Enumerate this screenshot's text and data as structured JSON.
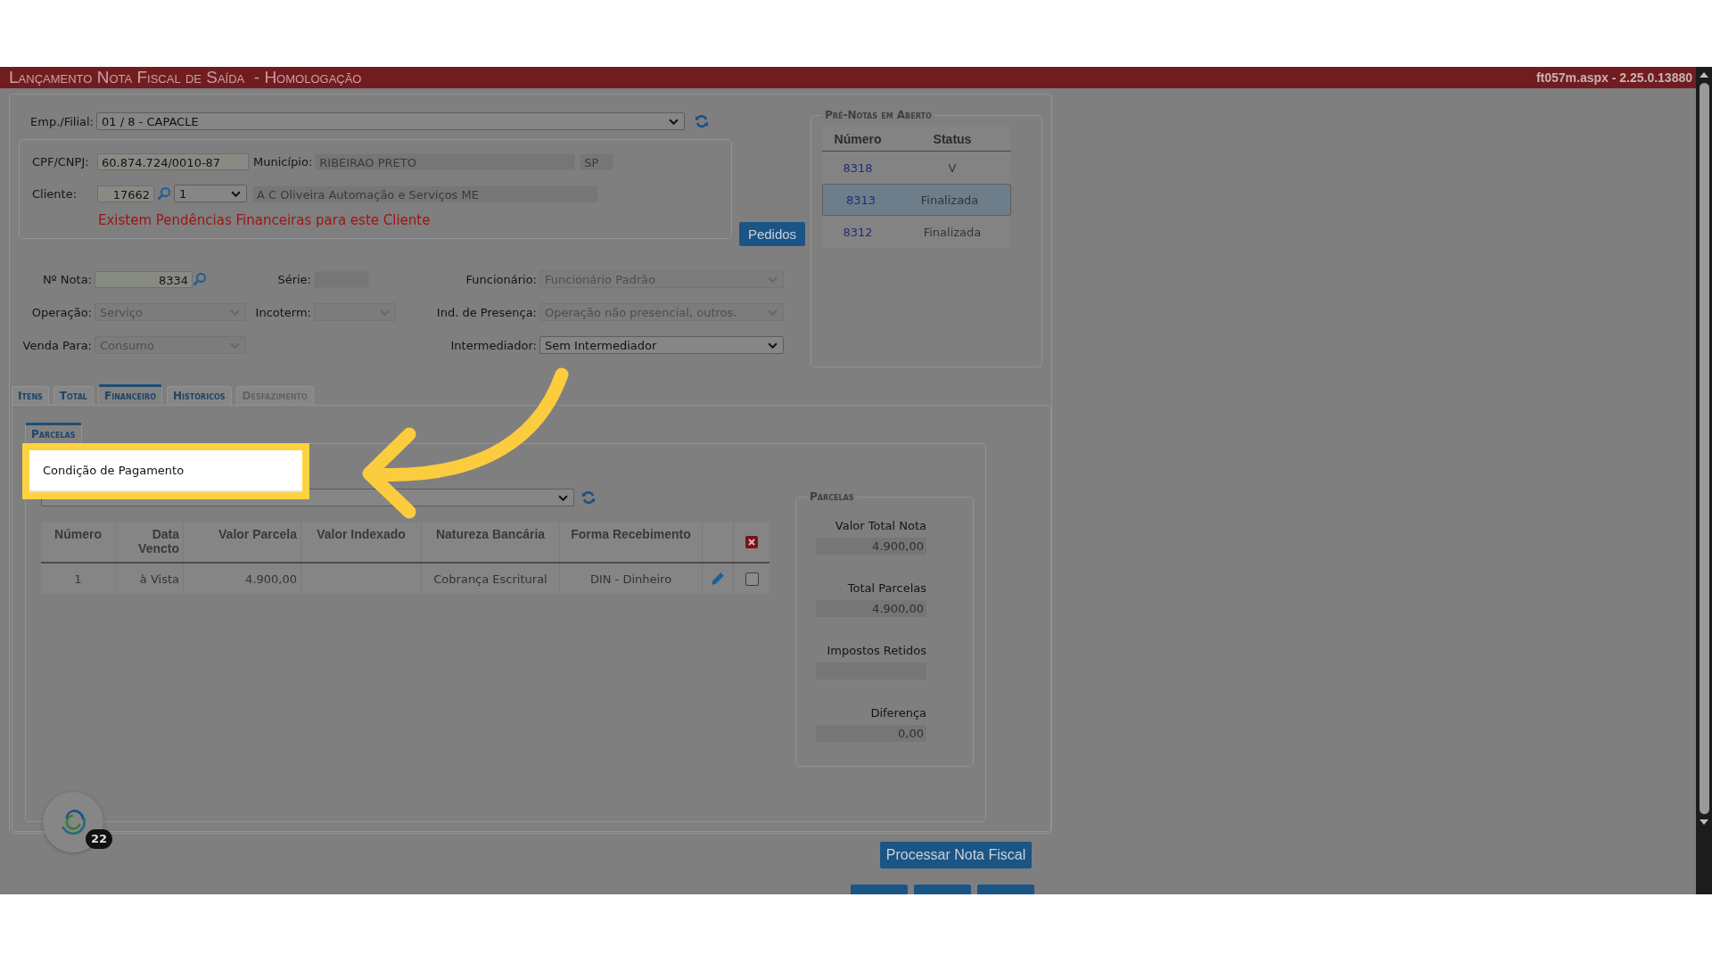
{
  "header": {
    "title": "Lançamento Nota Fiscal de Saída  - Homologação",
    "version": "ft057m.aspx - 2.25.0.13880"
  },
  "company": {
    "label": "Emp./Filial:",
    "value": "01 / 8 - CAPACLE"
  },
  "client": {
    "cpf_label": "CPF/CNPJ:",
    "cpf": "60.874.724/0010-87",
    "city_label": "Município:",
    "city": "RIBEIRAO PRETO",
    "state": "SP",
    "client_label": "Cliente:",
    "client_code": "17662",
    "client_seq": "1",
    "client_name": "A C Oliveira Automação e Serviços ME",
    "warning": "Existem Pendências Financeiras para este Cliente"
  },
  "orders_button": "Pedidos",
  "note_fields": [
    {
      "label": "Nº Nota:",
      "value": "8334",
      "kind": "lookup",
      "disabled": false
    },
    {
      "label": "Série:",
      "kind": "input",
      "disabled": true
    },
    {
      "label": "Funcionário:",
      "value": "Funcionário Padrão",
      "kind": "select",
      "disabled": true
    },
    {
      "label": "Operação:",
      "value": "Serviço",
      "kind": "select",
      "disabled": true
    },
    {
      "label": "Incoterm:",
      "kind": "select",
      "disabled": true
    },
    {
      "label": "Ind. de Presença:",
      "value": "Operação não presencial, outros.",
      "kind": "select",
      "disabled": true
    },
    {
      "label": "Venda Para:",
      "value": "Consumo",
      "kind": "select",
      "disabled": true
    },
    {
      "label": "Intermediador:",
      "value": "Sem Intermediador",
      "kind": "select",
      "disabled": false
    }
  ],
  "pre_notes": {
    "title": "Pré-Notas em Aberto",
    "columns": [
      "Número",
      "Status"
    ],
    "rows": [
      {
        "number": "8318",
        "status": "V",
        "selected": false
      },
      {
        "number": "8313",
        "status": "Finalizada",
        "selected": true
      },
      {
        "number": "8312",
        "status": "Finalizada",
        "selected": false
      }
    ]
  },
  "tabs": [
    {
      "label": "Itens",
      "selected": false,
      "disabled": false
    },
    {
      "label": "Total",
      "selected": false,
      "disabled": false
    },
    {
      "label": "Financeiro",
      "selected": true,
      "disabled": false
    },
    {
      "label": "Históricos",
      "selected": false,
      "disabled": false
    },
    {
      "label": "Desfazimento",
      "selected": false,
      "disabled": true
    }
  ],
  "subtab": {
    "label": "Parcelas",
    "selected": true
  },
  "payment_condition": {
    "label": "Condição de Pagamento"
  },
  "installments": {
    "columns": [
      "Número",
      "Data Vencto",
      "Valor Parcela",
      "Valor Indexado",
      "Natureza Bancária",
      "Forma Recebimento"
    ],
    "rows": [
      {
        "number": "1",
        "due": "à Vista",
        "value": "4.900,00",
        "bank_nature": "Cobrança Escritural",
        "receipt_form": "DIN - Dinheiro",
        "checked": false
      }
    ]
  },
  "summary": {
    "title": "Parcelas",
    "items": [
      {
        "label": "Valor Total Nota",
        "value": "4.900,00"
      },
      {
        "label": "Total Parcelas",
        "value": "4.900,00"
      },
      {
        "label": "Impostos Retidos"
      },
      {
        "label": "Diferença",
        "value": "0,00"
      }
    ]
  },
  "process_button": "Processar Nota Fiscal",
  "notification_count": "22"
}
